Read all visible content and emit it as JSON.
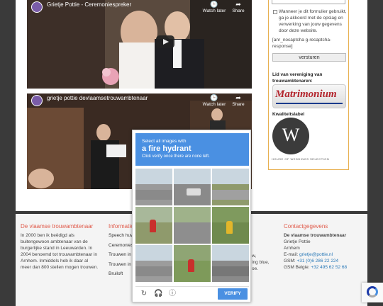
{
  "videos": [
    {
      "title": "Grietje Pottie - Ceremoniespreker",
      "watch_later": "Watch later",
      "share": "Share"
    },
    {
      "title": "grietje pottie devlaamsetrouwambtenaar",
      "watch_later": "Watch later",
      "share": "Share"
    }
  ],
  "sidebar": {
    "consent_text": "Wanneer je dit formulier gebruikt, ga je akkoord met de opslag en verwerking van jouw gegevens door deze website.",
    "nocaptcha_text": "[anr_nocaptcha g-recaptcha-response]",
    "send_label": "versturen",
    "lid_heading": "Lid van vereniging van trouwambtenaren:",
    "matrimonium_logo": "Matrimonium",
    "kwaliteit_heading": "Kwaliteitslabel",
    "seal_letter": "W",
    "seal_text": "HOUSE OF WEDDINGS SELECTION"
  },
  "footer": {
    "col1": {
      "heading": "De vlaamse trouwambtenaar",
      "text": "In 2000 ben ik beëdigd als buitengewoon ambtenaar van de burgerlijke stand in Leeuwarden. In 2004 benoemd tot trouwambtenaar in Arnhem. Inmiddels heb ik daar al meer dan 800 stellen mogen trouwen."
    },
    "col2": {
      "heading": "Informatie",
      "items": [
        "Speech huwe",
        "Ceremoniesp",
        "Trouwen in N",
        "Trouwen in B",
        "Bruiloft"
      ]
    },
    "col3_fragments": [
      "w,",
      "ing blue,",
      "oe."
    ],
    "col4": {
      "heading": "Contactgegevens",
      "name": "De vlaamse trouwambtenaar",
      "person": "Grietje Pottie",
      "city": "Arnhem",
      "email_label": "E-mail:",
      "email": "grietje@pottie.nl",
      "gsm_label": "GSM:",
      "gsm": "+31 (0)6 286 22 224",
      "gsm_be_label": "GSM Belgie:",
      "gsm_be": "+32 495 62 52 68"
    }
  },
  "captcha": {
    "line1": "Select all images with",
    "target": "a fire hydrant",
    "line3": "Click verify once there are none left.",
    "verify_label": "VERIFY"
  },
  "colors": {
    "accent_red": "#e05a4a",
    "link_blue": "#2a7ab8",
    "captcha_blue": "#4a90e2",
    "sidebar_border": "#e8b050"
  }
}
